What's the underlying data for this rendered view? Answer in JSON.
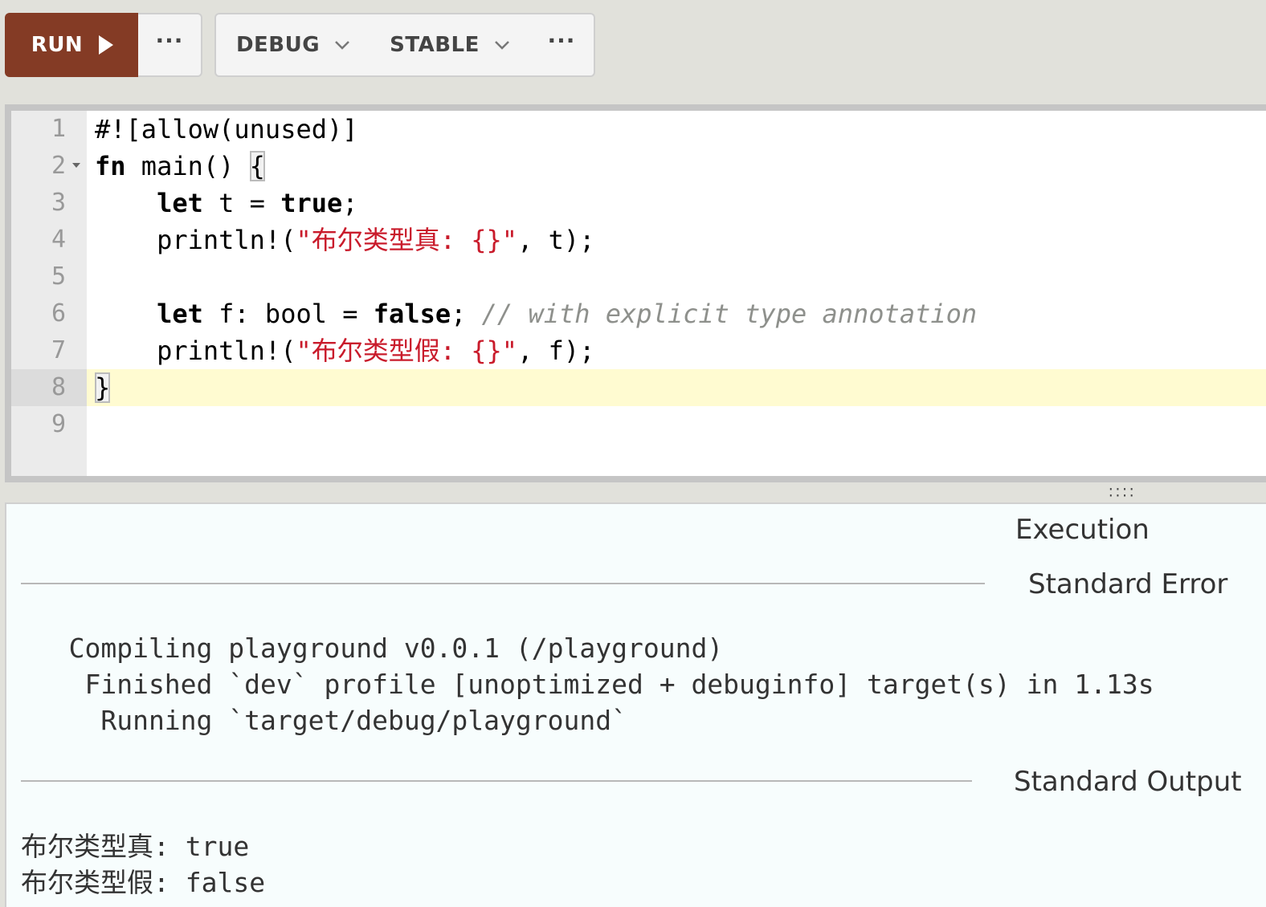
{
  "toolbar": {
    "run_label": "RUN",
    "more_glyph": "···",
    "debug_label": "DEBUG",
    "stable_label": "STABLE"
  },
  "editor": {
    "active_line": 8,
    "lines": [
      {
        "num": "1"
      },
      {
        "num": "2"
      },
      {
        "num": "3"
      },
      {
        "num": "4"
      },
      {
        "num": "5"
      },
      {
        "num": "6"
      },
      {
        "num": "7"
      },
      {
        "num": "8"
      },
      {
        "num": "9"
      }
    ],
    "code": {
      "l1": "#![allow(unused)]",
      "l2_kw": "fn",
      "l2_rest": " main() ",
      "l2_brace": "{",
      "l3_indent": "    ",
      "l3_kw1": "let",
      "l3_mid": " t = ",
      "l3_kw2": "true",
      "l3_end": ";",
      "l4_indent": "    ",
      "l4_fn": "println!(",
      "l4_str": "\"布尔类型真: {}\"",
      "l4_end": ", t);",
      "l6_indent": "    ",
      "l6_kw1": "let",
      "l6_mid": " f: bool = ",
      "l6_kw2": "false",
      "l6_end": "; ",
      "l6_cmt": "// with explicit type annotation",
      "l7_indent": "    ",
      "l7_fn": "println!(",
      "l7_str": "\"布尔类型假: {}\"",
      "l7_end": ", f);",
      "l8": "}"
    }
  },
  "output": {
    "execution_title": "Execution",
    "stderr_title": "Standard Error",
    "stderr_lines": [
      "   Compiling playground v0.0.1 (/playground)",
      "    Finished `dev` profile [unoptimized + debuginfo] target(s) in 1.13s",
      "     Running `target/debug/playground`"
    ],
    "stdout_title": "Standard Output",
    "stdout_lines": [
      "布尔类型真: true",
      "布尔类型假: false"
    ]
  },
  "colors": {
    "run_button": "#843b25",
    "string": "#c91b2b",
    "comment": "#8e908c",
    "active_line": "#fffbd1",
    "output_bg": "#f7fdfd"
  }
}
